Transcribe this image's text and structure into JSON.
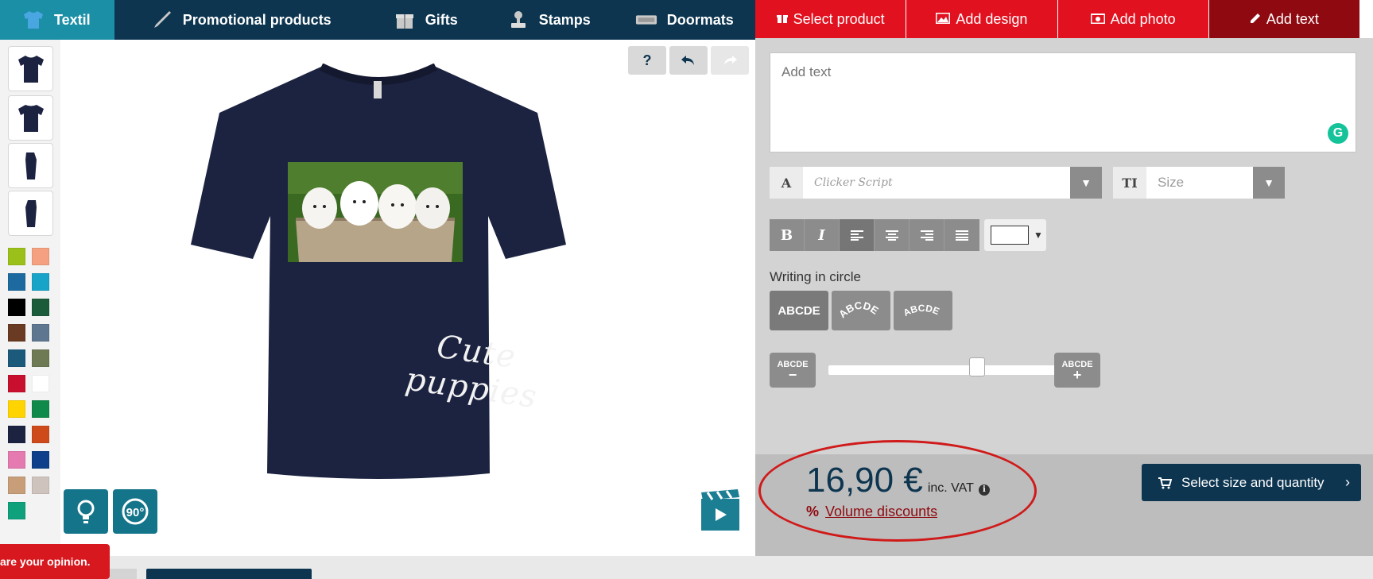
{
  "topnav": {
    "items": [
      {
        "label": "Textil",
        "icon": "tshirt-icon"
      },
      {
        "label": "Promotional products",
        "icon": "pen-icon"
      },
      {
        "label": "Gifts",
        "icon": "gift-icon"
      },
      {
        "label": "Stamps",
        "icon": "stamp-icon"
      },
      {
        "label": "Doormats",
        "icon": "doormat-icon"
      }
    ],
    "active": "Textil"
  },
  "steps": [
    {
      "label": "Select product",
      "icon": "gift-icon"
    },
    {
      "label": "Add design",
      "icon": "image-icon"
    },
    {
      "label": "Add photo",
      "icon": "camera-icon"
    },
    {
      "label": "Add text",
      "icon": "pencil-icon"
    }
  ],
  "canvas": {
    "help": "?",
    "shirt_color": "#1c2341",
    "printed_text": "Cute puppies",
    "buttons": [
      "lightbulb-icon",
      "rotate-90-icon",
      "video-tutorial-icon"
    ]
  },
  "swatches": [
    "#9cc01a",
    "#f5a080",
    "#1d6aa0",
    "#18a4c8",
    "#000000",
    "#1b5b3a",
    "#6a3a22",
    "#5e7690",
    "#1c5a7c",
    "#6e7a54",
    "#c8102e",
    "#ffffff",
    "#ffd400",
    "#0f8a4a",
    "#1c2341",
    "#cf4a1a",
    "#e47ab0",
    "#0f3f8a",
    "#c79e78",
    "#cfc4bd",
    "#0fa07c"
  ],
  "editor": {
    "text_placeholder": "Add text",
    "font_label": "A",
    "font_value": "Clicker Script",
    "size_label": "TI",
    "size_placeholder": "Size",
    "format": {
      "bold": "B",
      "italic": "I"
    },
    "writing_in_circle_label": "Writing in circle",
    "arc_options": [
      "ABCDE",
      "ABCDE",
      "ABCDE"
    ],
    "spacing_minus": "ABCDE",
    "spacing_plus": "ABCDE",
    "spacing_level": 0.6
  },
  "price": {
    "amount": "16,90 €",
    "vat": "inc. VAT",
    "discount_symbol": "%",
    "discount_link": "Volume discounts",
    "cta": "Select size and quantity"
  },
  "feedback": {
    "label": "are your opinion."
  },
  "colors": {
    "navy": "#0d3550",
    "red": "#e1111f",
    "dark_red": "#8e0a10",
    "teal": "#1a8fa6"
  }
}
